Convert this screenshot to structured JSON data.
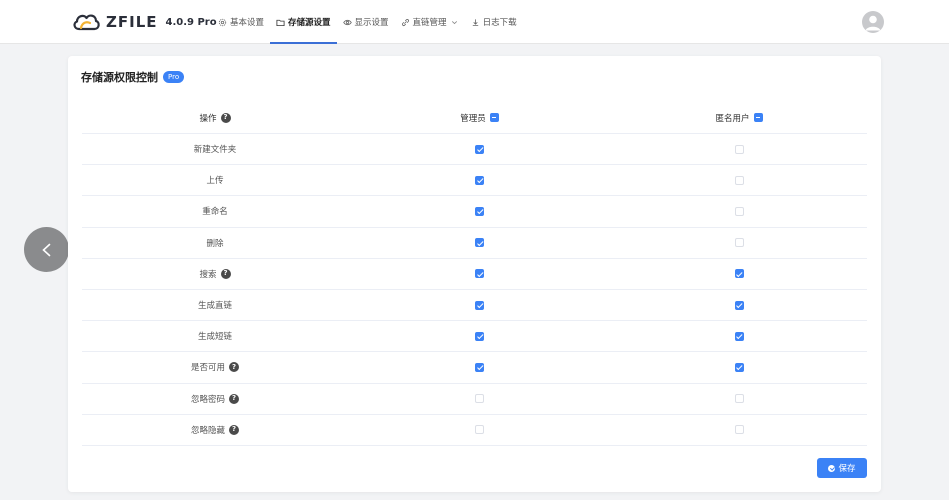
{
  "brand": {
    "name": "ZFILE",
    "version": "4.0.9 Pro"
  },
  "nav": [
    {
      "label": "基本设置",
      "icon": "gear-icon",
      "active": false
    },
    {
      "label": "存储源设置",
      "icon": "folder-icon",
      "active": true
    },
    {
      "label": "显示设置",
      "icon": "eye-icon",
      "active": false
    },
    {
      "label": "直链管理",
      "icon": "link-icon",
      "active": false,
      "dropdown": true
    },
    {
      "label": "日志下载",
      "icon": "download-icon",
      "active": false
    }
  ],
  "page": {
    "title": "存储源权限控制",
    "badge": "Pro"
  },
  "table": {
    "headers": {
      "operation": "操作",
      "admin": "管理员",
      "anonymous": "匿名用户"
    },
    "rows": [
      {
        "label": "新建文件夹",
        "help": false,
        "admin": true,
        "anonymous": false
      },
      {
        "label": "上传",
        "help": false,
        "admin": true,
        "anonymous": false
      },
      {
        "label": "重命名",
        "help": false,
        "admin": true,
        "anonymous": false
      },
      {
        "label": "删除",
        "help": false,
        "admin": true,
        "anonymous": false
      },
      {
        "label": "搜索",
        "help": true,
        "admin": true,
        "anonymous": true
      },
      {
        "label": "生成直链",
        "help": false,
        "admin": true,
        "anonymous": true
      },
      {
        "label": "生成短链",
        "help": false,
        "admin": true,
        "anonymous": true
      },
      {
        "label": "是否可用",
        "help": true,
        "admin": true,
        "anonymous": true
      },
      {
        "label": "忽略密码",
        "help": true,
        "admin": false,
        "anonymous": false
      },
      {
        "label": "忽略隐藏",
        "help": true,
        "admin": false,
        "anonymous": false
      }
    ]
  },
  "actions": {
    "save_label": "保存"
  },
  "colors": {
    "accent": "#3b82f6",
    "nav_active": "#3b6fd6"
  }
}
